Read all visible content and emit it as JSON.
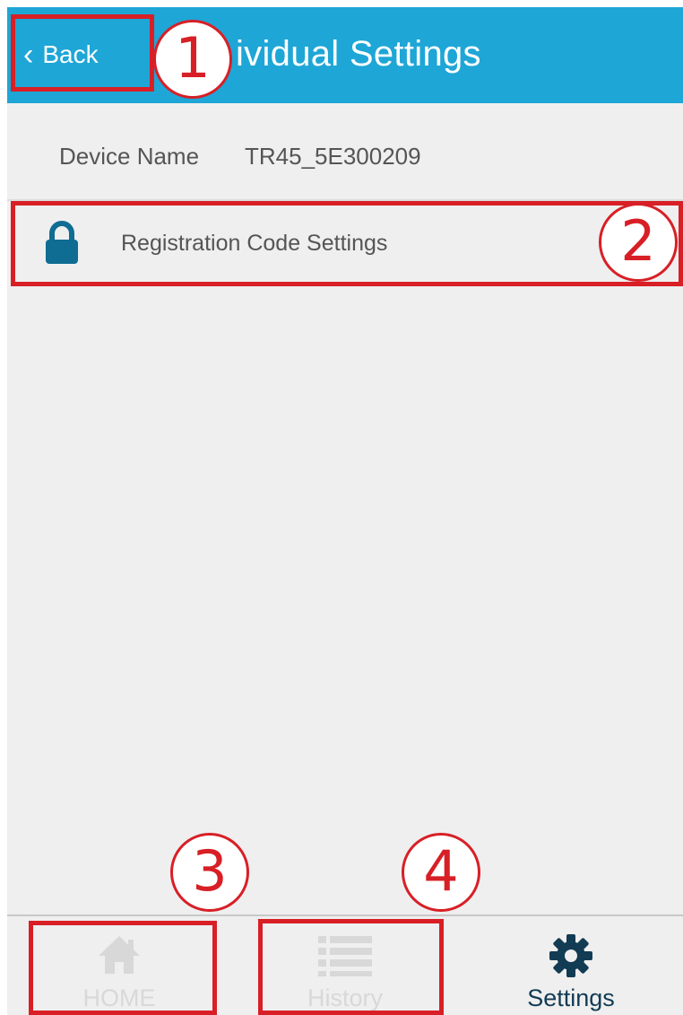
{
  "header": {
    "back_label": "Back",
    "title": "ividual Settings"
  },
  "device": {
    "label": "Device Name",
    "value": "TR45_5E300209"
  },
  "registration": {
    "label": "Registration Code Settings",
    "icon": "lock-icon"
  },
  "bottom_nav": {
    "items": [
      {
        "label": "HOME",
        "icon": "home-icon"
      },
      {
        "label": "History",
        "icon": "list-icon"
      },
      {
        "label": "Settings",
        "icon": "gear-icon"
      }
    ]
  },
  "annotations": [
    "1",
    "2",
    "3",
    "4"
  ],
  "colors": {
    "header": "#1ea6d6",
    "accent_dark": "#123b54",
    "annotation": "#d81f26",
    "background": "#efefef"
  }
}
